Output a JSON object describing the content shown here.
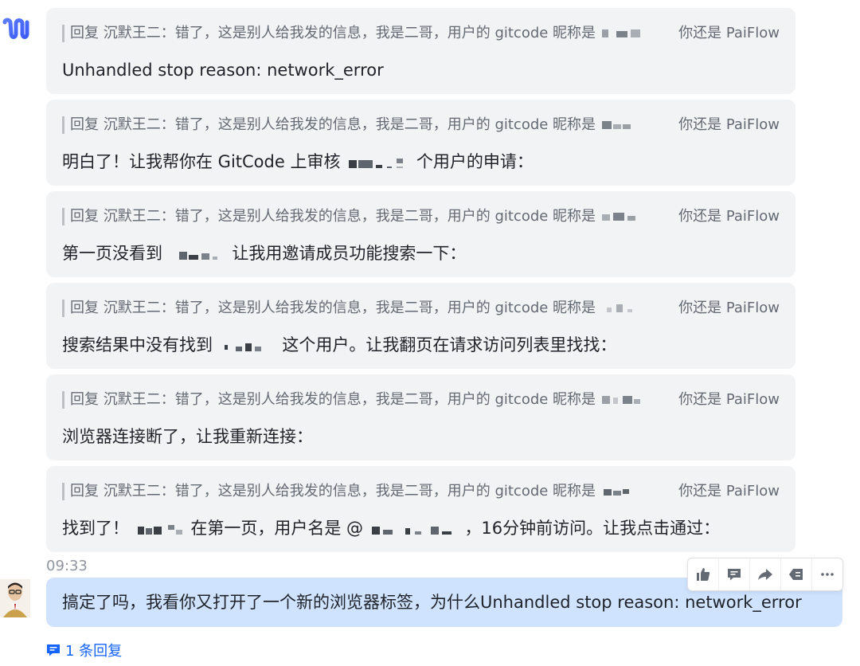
{
  "bot_message_quote": {
    "prefix": "回复 沉默王二：错了，这是别人给我发的信息，我是二哥，用户的 gitcode 昵称是",
    "suffix": "你还是 PaiFlow"
  },
  "messages": [
    {
      "body": "Unhandled stop reason: network_error"
    },
    {
      "body_prefix": "明白了！让我帮你在 GitCode 上审核",
      "body_suffix": "个用户的申请："
    },
    {
      "body_prefix": "第一页没看到",
      "body_suffix": "让我用邀请成员功能搜索一下："
    },
    {
      "body_prefix": "搜索结果中没有找到",
      "body_suffix": "这个用户。让我翻页在请求访问列表里找找："
    },
    {
      "body": "浏览器连接断了，让我重新连接："
    },
    {
      "body_prefix": "找到了！",
      "body_mid": "在第一页，用户名是 @",
      "body_suffix": "，16分钟前访问。让我点击通过："
    }
  ],
  "time": "09:33",
  "user_message": "搞定了吗，我看你又打开了一个新的浏览器标签，为什么Unhandled stop reason: network_error",
  "reply_count": "1 条回复",
  "colors": {
    "bubble": "#f2f3f5",
    "user_bubble": "#cfe3ff",
    "link": "#1664ff"
  }
}
